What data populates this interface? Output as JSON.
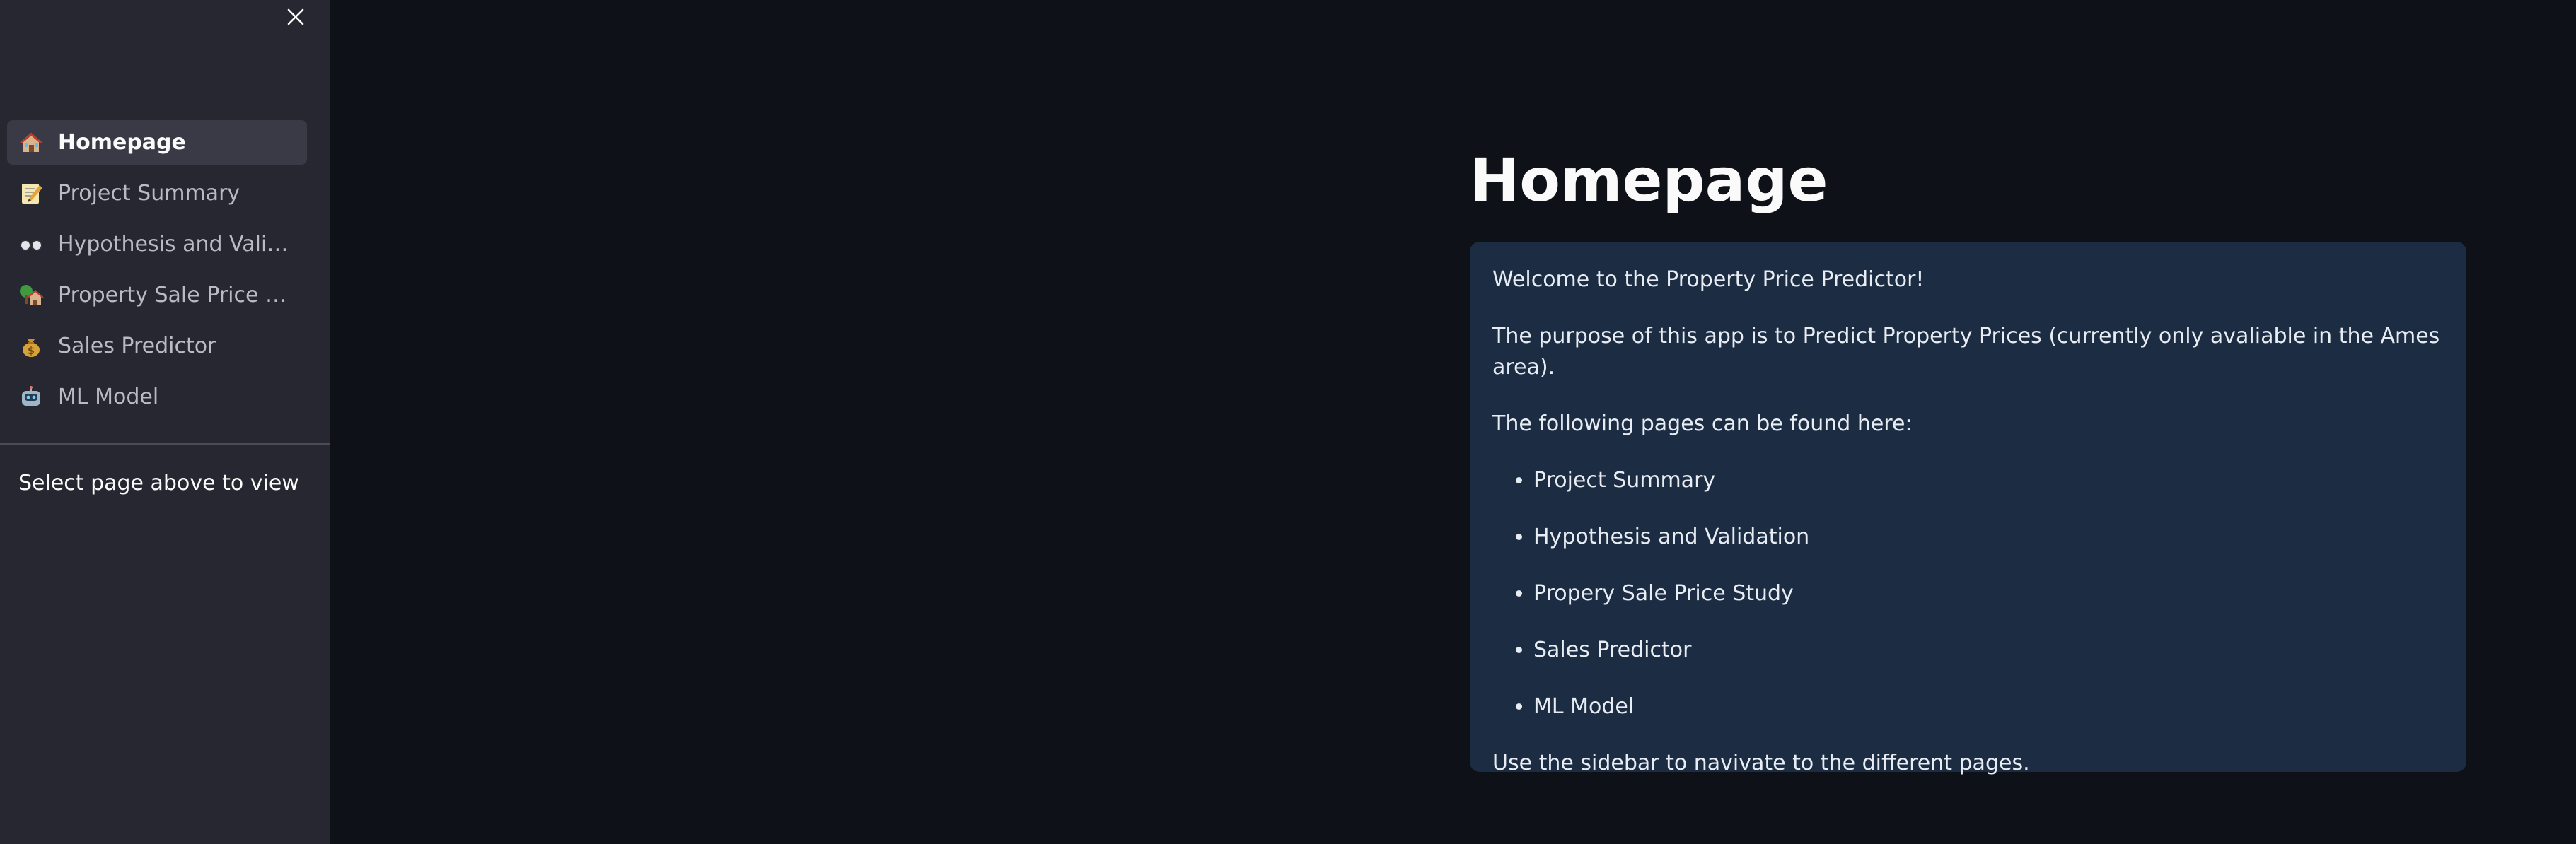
{
  "sidebar": {
    "close_icon": "close-icon",
    "items": [
      {
        "label": "Homepage",
        "icon": "house-icon",
        "active": true
      },
      {
        "label": "Project Summary",
        "icon": "memo-icon",
        "active": false
      },
      {
        "label": "Hypothesis and Validat…",
        "icon": "glasses-icon",
        "active": false
      },
      {
        "label": "Property Sale Price Stu…",
        "icon": "house-tree-icon",
        "active": false
      },
      {
        "label": "Sales Predictor",
        "icon": "money-bag-icon",
        "active": false
      },
      {
        "label": "ML Model",
        "icon": "robot-icon",
        "active": false
      }
    ],
    "note": "Select page above to view"
  },
  "main": {
    "title": "Homepage",
    "info": {
      "welcome": "Welcome to the Property Price Predictor!",
      "purpose": "The purpose of this app is to Predict Property Prices (currently only avaliable in the Ames area).",
      "pages_intro": "The following pages can be found here:",
      "pages": [
        "Project Summary",
        "Hypothesis and Validation",
        "Propery Sale Price Study",
        "Sales Predictor",
        "ML Model"
      ],
      "footer": "Use the sidebar to navivate to the different pages."
    }
  },
  "colors": {
    "background": "#0e1117",
    "sidebar": "#262730",
    "info_box": "#1c2c43",
    "text": "#fafafa"
  }
}
